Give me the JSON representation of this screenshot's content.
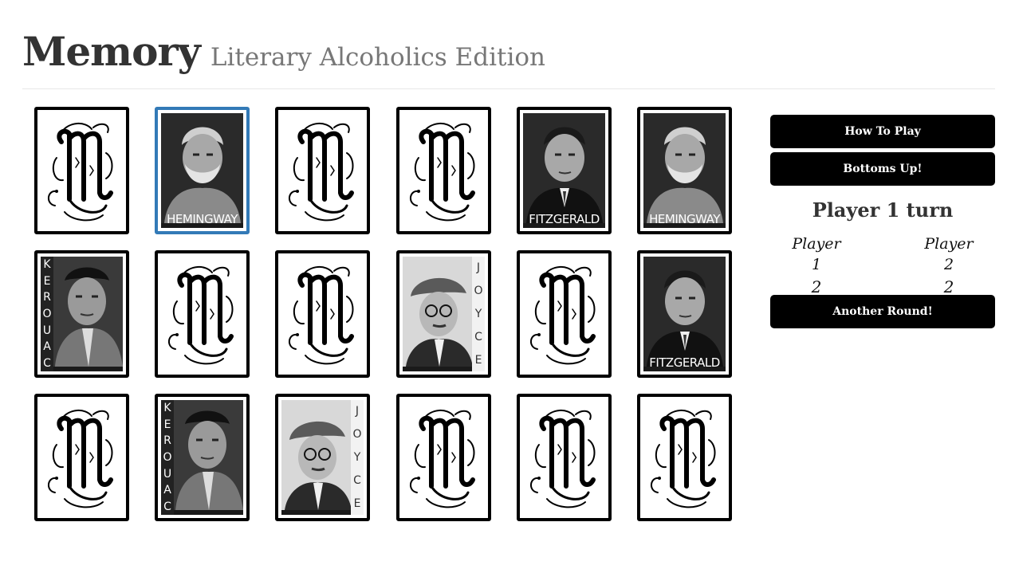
{
  "header": {
    "title": "Memory",
    "subtitle": "Literary Alcoholics Edition"
  },
  "board": {
    "rows": 3,
    "columns": 6,
    "cards": [
      {
        "state": "hidden"
      },
      {
        "state": "revealed",
        "author": "HEMINGWAY",
        "selected": true
      },
      {
        "state": "hidden"
      },
      {
        "state": "hidden"
      },
      {
        "state": "revealed",
        "author": "FITZGERALD"
      },
      {
        "state": "revealed",
        "author": "HEMINGWAY"
      },
      {
        "state": "revealed",
        "author": "KEROUAC"
      },
      {
        "state": "hidden"
      },
      {
        "state": "hidden"
      },
      {
        "state": "revealed",
        "author": "JOYCE"
      },
      {
        "state": "hidden"
      },
      {
        "state": "revealed",
        "author": "FITZGERALD"
      },
      {
        "state": "hidden"
      },
      {
        "state": "revealed",
        "author": "KEROUAC"
      },
      {
        "state": "revealed",
        "author": "JOYCE"
      },
      {
        "state": "hidden"
      },
      {
        "state": "hidden"
      },
      {
        "state": "hidden"
      }
    ]
  },
  "sidebar": {
    "how_to_play": "How To Play",
    "bottoms_up": "Bottoms Up!",
    "turn": "Player 1 turn",
    "players": [
      {
        "name": "Player 1",
        "score": "2"
      },
      {
        "name": "Player 2",
        "score": "2"
      }
    ],
    "another_round": "Another Round!"
  },
  "colors": {
    "card_border": "#000000",
    "selected_border": "#337ab7",
    "button_bg": "#000000",
    "button_text": "#ffffff"
  }
}
